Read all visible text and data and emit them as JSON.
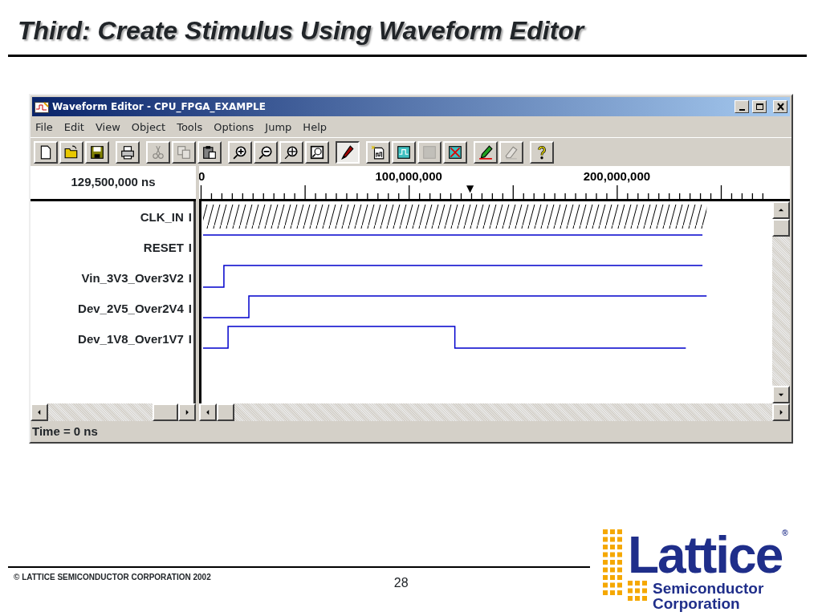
{
  "slide": {
    "title": "Third: Create Stimulus Using Waveform Editor"
  },
  "window": {
    "title": "Waveform Editor - CPU_FPGA_EXAMPLE"
  },
  "menu": [
    "File",
    "Edit",
    "View",
    "Object",
    "Tools",
    "Options",
    "Jump",
    "Help"
  ],
  "toolbar": [
    {
      "buttons": [
        {
          "kind": "new",
          "disabled": false,
          "pressed": false
        },
        {
          "kind": "open",
          "disabled": false,
          "pressed": false
        },
        {
          "kind": "save",
          "disabled": false,
          "pressed": false
        }
      ]
    },
    {
      "buttons": [
        {
          "kind": "print",
          "disabled": false,
          "pressed": false
        }
      ]
    },
    {
      "buttons": [
        {
          "kind": "cut",
          "disabled": true,
          "pressed": false
        },
        {
          "kind": "copy",
          "disabled": true,
          "pressed": false
        },
        {
          "kind": "paste",
          "disabled": false,
          "pressed": false
        }
      ]
    },
    {
      "buttons": [
        {
          "kind": "zoom-in",
          "disabled": false,
          "pressed": false
        },
        {
          "kind": "zoom-out",
          "disabled": false,
          "pressed": false
        },
        {
          "kind": "zoom-fit",
          "disabled": false,
          "pressed": false
        },
        {
          "kind": "zoom-window",
          "disabled": false,
          "pressed": false
        }
      ]
    },
    {
      "buttons": [
        {
          "kind": "pencil",
          "disabled": false,
          "pressed": true
        }
      ]
    },
    {
      "buttons": [
        {
          "kind": "new-wave",
          "disabled": false,
          "pressed": false
        },
        {
          "kind": "wave-box",
          "disabled": false,
          "pressed": false
        },
        {
          "kind": "grid",
          "disabled": true,
          "pressed": false
        },
        {
          "kind": "wave-x",
          "disabled": false,
          "pressed": false
        }
      ]
    },
    {
      "buttons": [
        {
          "kind": "color-pencil",
          "disabled": false,
          "pressed": false
        },
        {
          "kind": "eraser",
          "disabled": true,
          "pressed": false
        }
      ]
    },
    {
      "buttons": [
        {
          "kind": "help",
          "disabled": false,
          "pressed": false
        }
      ]
    }
  ],
  "time_label": "129,500,000 ns",
  "ruler": {
    "labels": [
      "0",
      "100,000,000",
      "200,000,000"
    ],
    "cursor": "▼"
  },
  "signals": [
    {
      "name": "CLK_IN",
      "direction": "I",
      "kind": "clock"
    },
    {
      "name": "RESET",
      "direction": "I",
      "kind": "high"
    },
    {
      "name": "Vin_3V3_Over3V2",
      "direction": "I",
      "kind": "rise"
    },
    {
      "name": "Dev_2V5_Over2V4",
      "direction": "I",
      "kind": "rise"
    },
    {
      "name": "Dev_1V8_Over1V7",
      "direction": "I",
      "kind": "pulse"
    }
  ],
  "status_bar": "Time = 0 ns",
  "footer": {
    "copyright": "© LATTICE SEMICONDUCTOR CORPORATION 2002",
    "page": "28"
  },
  "logo": {
    "name": "Lattice",
    "registered": "®",
    "line_1": "Semiconductor",
    "line_2": "Corporation"
  }
}
